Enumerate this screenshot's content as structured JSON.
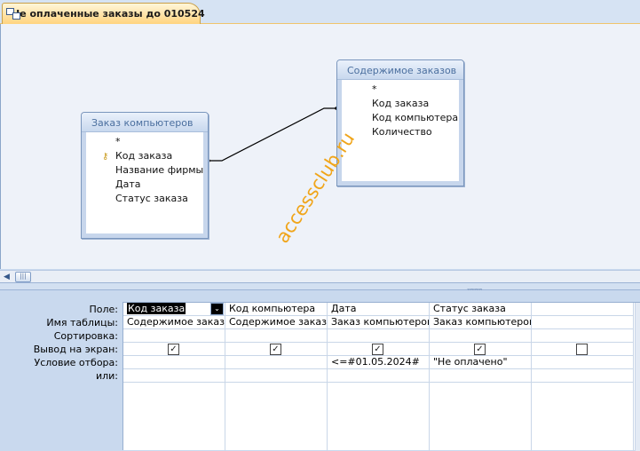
{
  "tab": {
    "title": "Не оплаченные заказы до 010524",
    "icon": "query-icon"
  },
  "tables": [
    {
      "title": "Заказ компьютеров",
      "fields": [
        "*",
        "Код заказа",
        "Название фирмы",
        "Дата",
        "Статус заказа"
      ],
      "key_field_index": 1
    },
    {
      "title": "Содержимое заказов",
      "fields": [
        "*",
        "Код заказа",
        "Код компьютера",
        "Количество"
      ],
      "key_field_index": null
    }
  ],
  "watermark": "accessclub.ru",
  "grid": {
    "row_labels": [
      "Поле:",
      "Имя таблицы:",
      "Сортировка:",
      "Вывод на экран:",
      "Условие отбора:",
      "или:"
    ],
    "columns": [
      {
        "field": "Код заказа",
        "table": "Содержимое заказов",
        "sort": "",
        "show": true,
        "criteria": "",
        "or": ""
      },
      {
        "field": "Код компьютера",
        "table": "Содержимое заказов",
        "sort": "",
        "show": true,
        "criteria": "",
        "or": ""
      },
      {
        "field": "Дата",
        "table": "Заказ компьютеров",
        "sort": "",
        "show": true,
        "criteria": "<=#01.05.2024#",
        "or": ""
      },
      {
        "field": "Статус заказа",
        "table": "Заказ компьютеров",
        "sort": "",
        "show": true,
        "criteria": "\"Не оплачено\"",
        "or": ""
      },
      {
        "field": "",
        "table": "",
        "sort": "",
        "show": false,
        "criteria": "",
        "or": ""
      }
    ]
  }
}
